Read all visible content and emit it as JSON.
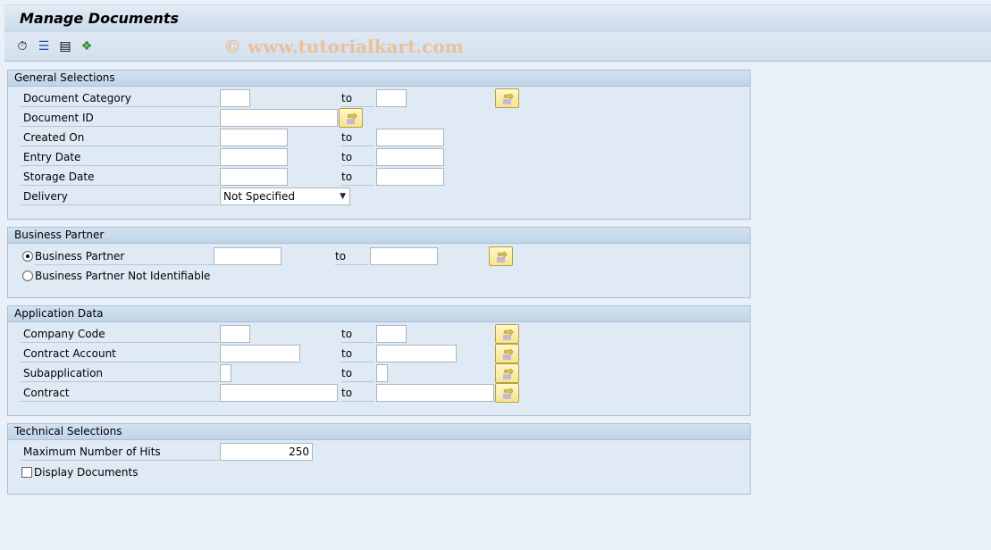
{
  "title": "Manage Documents",
  "watermark": "© www.tutorialkart.com",
  "toolbar": {
    "icons": [
      "execute-clock-icon",
      "select-options-icon",
      "get-variant-icon",
      "hierarchy-icon"
    ]
  },
  "general": {
    "title": "General Selections",
    "to": "to",
    "document_category": "Document Category",
    "document_id": "Document ID",
    "created_on": "Created On",
    "entry_date": "Entry Date",
    "storage_date": "Storage Date",
    "delivery": "Delivery",
    "delivery_value": "Not Specified"
  },
  "bp": {
    "title": "Business Partner",
    "to": "to",
    "opt1": "Business Partner",
    "opt2": "Business Partner Not Identifiable",
    "selected": "Business Partner"
  },
  "app": {
    "title": "Application Data",
    "to": "to",
    "company_code": "Company Code",
    "contract_account": "Contract Account",
    "subapplication": "Subapplication",
    "contract": "Contract"
  },
  "tech": {
    "title": "Technical Selections",
    "max_hits": "Maximum Number of Hits",
    "max_hits_value": "250",
    "display_documents": "Display Documents",
    "display_checked": false
  },
  "colors": {
    "button": "#f7e38d",
    "group_bg": "#dfeaf5",
    "header": "#c4d6e9"
  }
}
